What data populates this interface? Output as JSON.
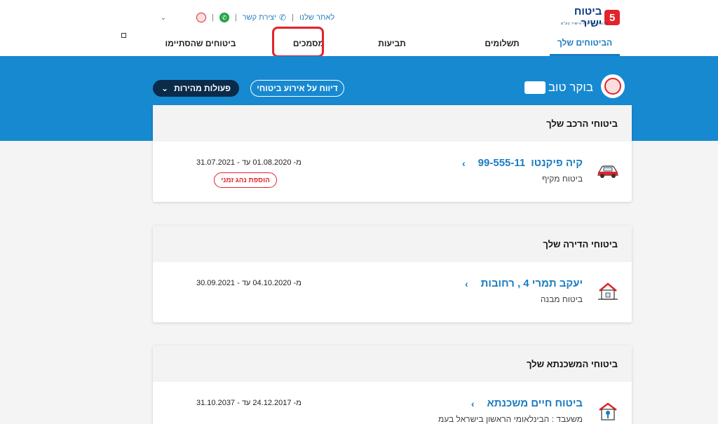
{
  "brand": {
    "name": "ביטוח ישיר",
    "badge": "5",
    "tagline": "קבוצת הביטוח הישיר בע\"מ"
  },
  "topbar": {
    "website": "לאתר שלנו",
    "contact": "יצירת קשר"
  },
  "nav": {
    "tabs": [
      {
        "label": "הביטוחים שלך",
        "active": true
      },
      {
        "label": "תשלומים",
        "active": false
      },
      {
        "label": "תביעות",
        "active": false
      },
      {
        "label": "מסמכים",
        "active": false
      },
      {
        "label": "ביטוחים שהסתיימו",
        "active": false
      }
    ]
  },
  "banner": {
    "greeting": "בוקר טוב",
    "report_button": "דיווח על אירוע ביטוחי",
    "quick_actions": "פעולות מהירות"
  },
  "cards": [
    {
      "title": "ביטוחי הרכב שלך",
      "item_title": "קיה פיקנטו",
      "item_id": "99-555-11",
      "subtitle": "ביטוח מקיף",
      "dates": "מ- 01.08.2020 עד - 31.07.2021",
      "badge": "הוספת נהג זמני"
    },
    {
      "title": "ביטוחי הדירה שלך",
      "item_title": "יעקב תמרי 4 , רחובות",
      "subtitle": "ביטוח מבנה",
      "dates": "מ- 04.10.2020 עד - 30.09.2021"
    },
    {
      "title": "ביטוחי המשכנתא שלך",
      "item_title": "ביטוח חיים משכנתא",
      "subtitle": "משעבד : הבינלאומי הראשון בישראל בעמ",
      "dates": "מ- 24.12.2017 עד - 31.10.2037"
    }
  ],
  "colors": {
    "accent": "#1789d1",
    "brand_red": "#e3232b",
    "dark_button": "#0b2b4a"
  }
}
